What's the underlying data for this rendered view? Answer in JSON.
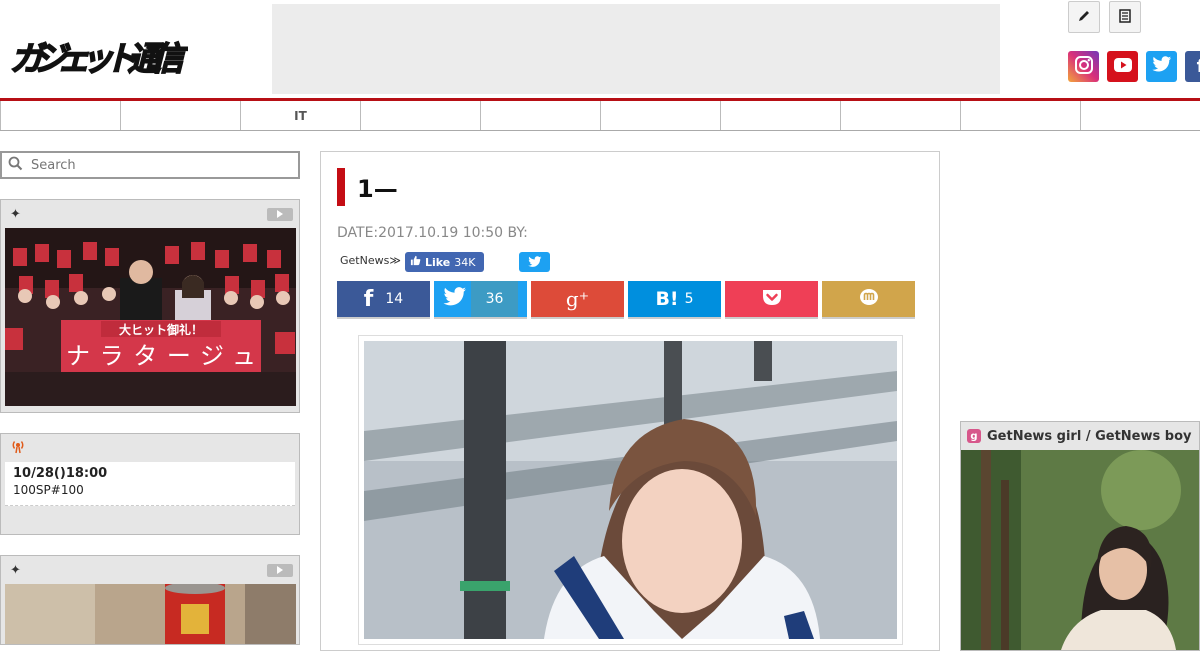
{
  "header": {
    "logo_text": "ガジェット通信",
    "social": [
      "instagram",
      "youtube",
      "twitter",
      "facebook"
    ]
  },
  "nav": {
    "items": [
      "",
      "",
      "IT",
      "",
      "",
      "",
      "",
      "",
      "",
      ""
    ]
  },
  "search": {
    "placeholder": "Search"
  },
  "left": {
    "widget1": {
      "star": "✦",
      "caption_banner": "大ヒット御礼！",
      "caption_title": "ナラタージュ"
    },
    "live": {
      "time": "10/28()18:00",
      "title": "100SP#100"
    },
    "widget3": {
      "star": "✦"
    }
  },
  "article": {
    "title": "1—",
    "date": "DATE:2017.10.19 10:50 BY:",
    "getnews_label": "GetNews≫",
    "fb_like_label": "Like",
    "fb_like_count": "34K",
    "share": {
      "facebook_count": "14",
      "twitter_count": "36",
      "gplus_label": "g⁺",
      "hatena_label": "B!",
      "hatena_count": "5"
    }
  },
  "right": {
    "widget_title": "GetNews girl / GetNews boy",
    "widget_icon_letter": "g"
  },
  "colors": {
    "brand_red": "#c40d14",
    "facebook": "#3b5998",
    "twitter": "#1da1f2",
    "hatena": "#008fde",
    "pocket": "#ef3f56",
    "mixi": "#d1a54b",
    "gplus": "#dd4b39"
  }
}
